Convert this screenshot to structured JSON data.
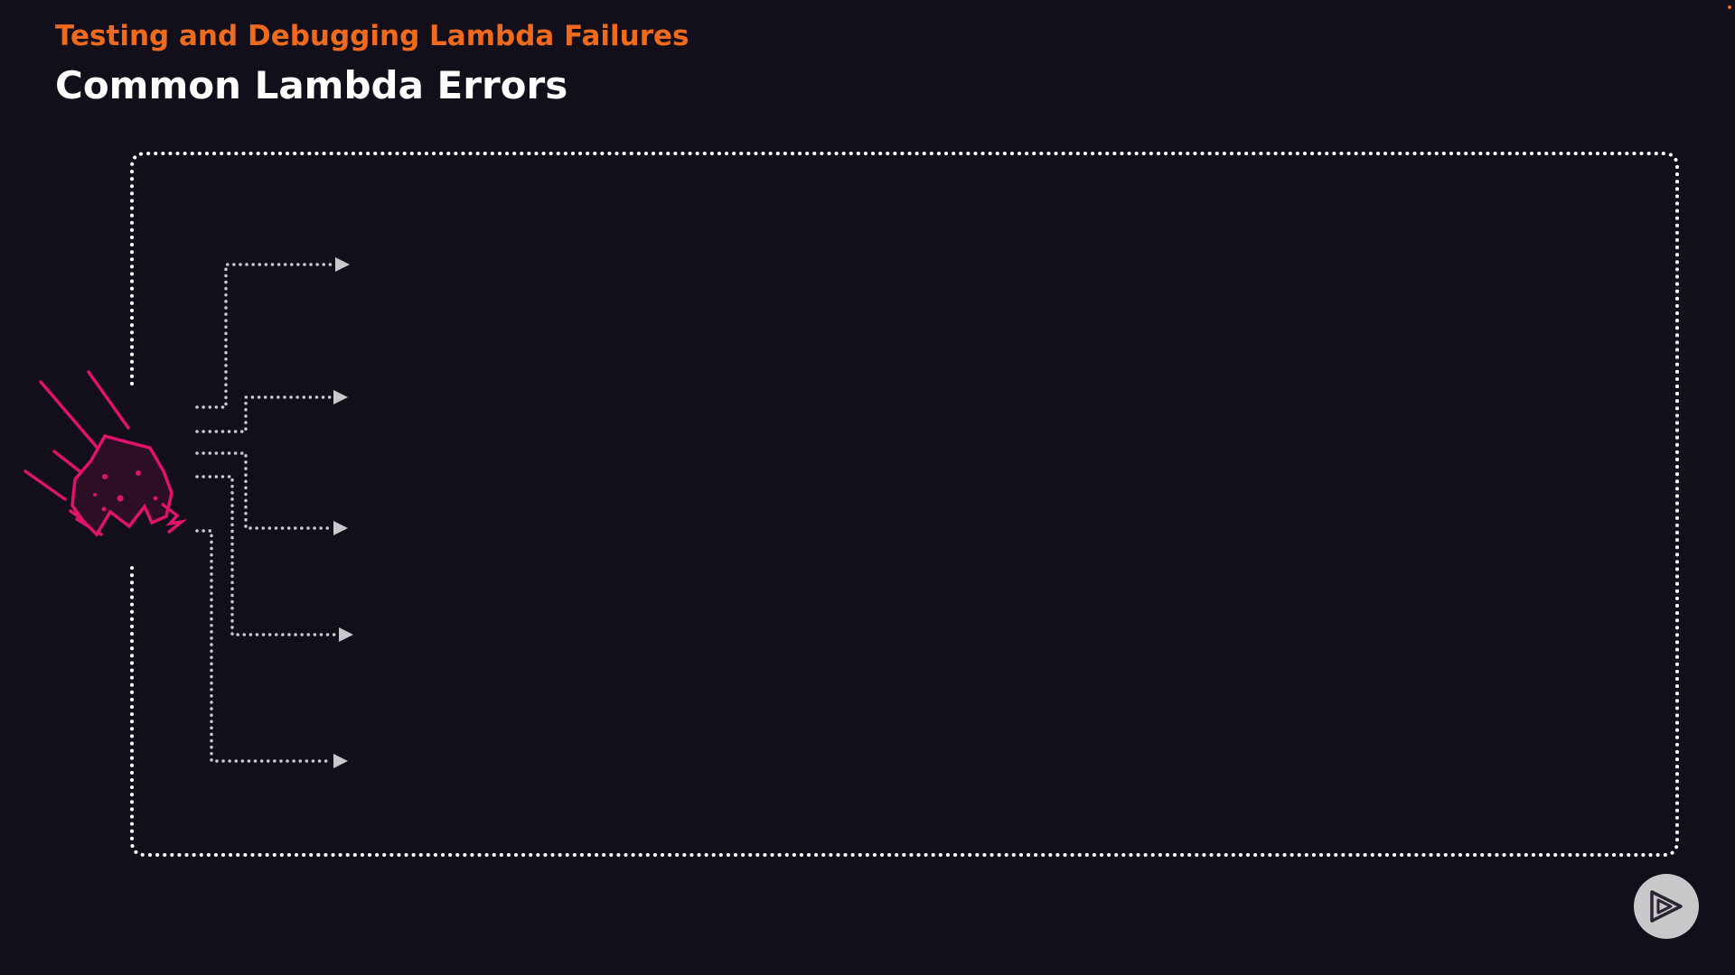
{
  "header": {
    "section": "Testing and Debugging Lambda Failures",
    "title": "Common Lambda Errors"
  },
  "diagram": {
    "branch_count": 5,
    "icon": "error-splat-icon"
  },
  "logo": {
    "icon": "play-logo-icon"
  },
  "colors": {
    "background": "#120f1b",
    "accent": "#f06a1d",
    "error": "#e0136b",
    "line": "#ffffff",
    "branch": "#c9c9cc"
  }
}
